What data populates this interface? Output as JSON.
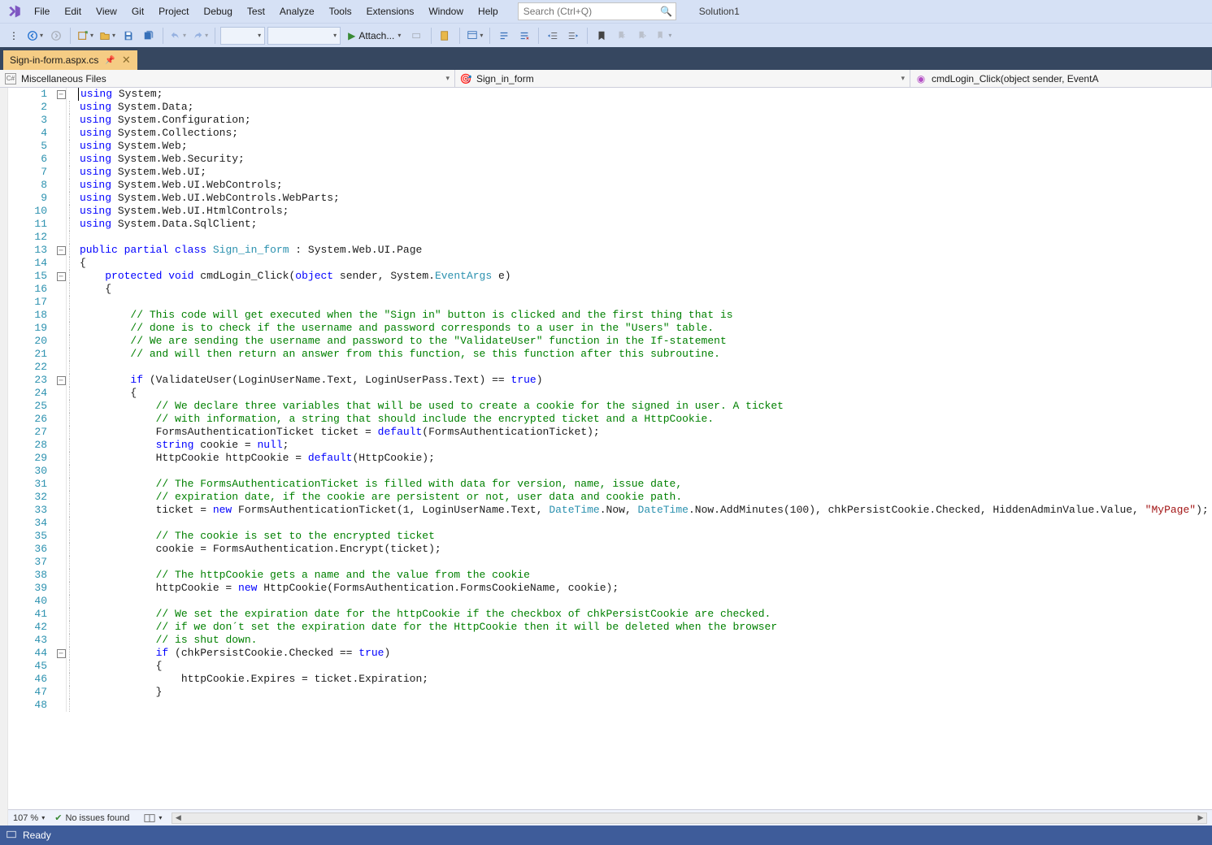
{
  "menu": {
    "file": "File",
    "edit": "Edit",
    "view": "View",
    "git": "Git",
    "project": "Project",
    "debug": "Debug",
    "test": "Test",
    "analyze": "Analyze",
    "tools": "Tools",
    "extensions": "Extensions",
    "window": "Window",
    "help": "Help"
  },
  "search_placeholder": "Search (Ctrl+Q)",
  "solution_name": "Solution1",
  "toolbar": {
    "attach": "Attach..."
  },
  "tab": {
    "filename": "Sign-in-form.aspx.cs"
  },
  "nav": {
    "project": "Miscellaneous Files",
    "class": "Sign_in_form",
    "member": "cmdLogin_Click(object sender, EventA"
  },
  "code": {
    "lines": [
      {
        "n": 1,
        "fold": "box",
        "guide": false,
        "html": "<span class='kw'>using</span> System;",
        "cursor": true
      },
      {
        "n": 2,
        "html": "<span class='kw'>using</span> System.Data;"
      },
      {
        "n": 3,
        "html": "<span class='kw'>using</span> System.Configuration;"
      },
      {
        "n": 4,
        "html": "<span class='kw'>using</span> System.Collections;"
      },
      {
        "n": 5,
        "html": "<span class='kw'>using</span> System.Web;"
      },
      {
        "n": 6,
        "html": "<span class='kw'>using</span> System.Web.Security;"
      },
      {
        "n": 7,
        "html": "<span class='kw'>using</span> System.Web.UI;"
      },
      {
        "n": 8,
        "html": "<span class='kw'>using</span> System.Web.UI.WebControls;"
      },
      {
        "n": 9,
        "html": "<span class='kw'>using</span> System.Web.UI.WebControls.WebParts;"
      },
      {
        "n": 10,
        "html": "<span class='kw'>using</span> System.Web.UI.HtmlControls;"
      },
      {
        "n": 11,
        "html": "<span class='kw'>using</span> System.Data.SqlClient;"
      },
      {
        "n": 12,
        "html": ""
      },
      {
        "n": 13,
        "fold": "box",
        "html": "<span class='kw'>public</span> <span class='kw'>partial</span> <span class='kw'>class</span> <span class='typ'>Sign_in_form</span> : System.Web.UI.Page"
      },
      {
        "n": 14,
        "html": "{"
      },
      {
        "n": 15,
        "fold": "box",
        "html": "    <span class='kw'>protected</span> <span class='kw'>void</span> cmdLogin_Click(<span class='kw'>object</span> sender, System.<span class='typ'>EventArgs</span> e)"
      },
      {
        "n": 16,
        "html": "    {"
      },
      {
        "n": 17,
        "html": ""
      },
      {
        "n": 18,
        "html": "        <span class='cm'>// This code will get executed when the \"Sign in\" button is clicked and the first thing that is</span>"
      },
      {
        "n": 19,
        "html": "        <span class='cm'>// done is to check if the username and password corresponds to a user in the \"Users\" table.</span>"
      },
      {
        "n": 20,
        "html": "        <span class='cm'>// We are sending the username and password to the \"ValidateUser\" function in the If-statement</span>"
      },
      {
        "n": 21,
        "html": "        <span class='cm'>// and will then return an answer from this function, se this function after this subroutine.</span>"
      },
      {
        "n": 22,
        "html": ""
      },
      {
        "n": 23,
        "fold": "box",
        "html": "        <span class='kw'>if</span> (ValidateUser(LoginUserName.Text, LoginUserPass.Text) == <span class='kw'>true</span>)"
      },
      {
        "n": 24,
        "html": "        {"
      },
      {
        "n": 25,
        "html": "            <span class='cm'>// We declare three variables that will be used to create a cookie for the signed in user. A ticket</span>"
      },
      {
        "n": 26,
        "html": "            <span class='cm'>// with information, a string that should include the encrypted ticket and a HttpCookie.</span>"
      },
      {
        "n": 27,
        "html": "            FormsAuthenticationTicket ticket = <span class='kw'>default</span>(FormsAuthenticationTicket);"
      },
      {
        "n": 28,
        "html": "            <span class='kw'>string</span> cookie = <span class='kw'>null</span>;"
      },
      {
        "n": 29,
        "html": "            HttpCookie httpCookie = <span class='kw'>default</span>(HttpCookie);"
      },
      {
        "n": 30,
        "html": ""
      },
      {
        "n": 31,
        "html": "            <span class='cm'>// The FormsAuthenticationTicket is filled with data for version, name, issue date,</span>"
      },
      {
        "n": 32,
        "html": "            <span class='cm'>// expiration date, if the cookie are persistent or not, user data and cookie path.</span>"
      },
      {
        "n": 33,
        "html": "            ticket = <span class='kw'>new</span> FormsAuthenticationTicket(1, LoginUserName.Text, <span class='typ'>DateTime</span>.Now, <span class='typ'>DateTime</span>.Now.AddMinutes(100), chkPersistCookie.Checked, HiddenAdminValue.Value, <span class='str'>\"MyPage\"</span>);"
      },
      {
        "n": 34,
        "html": ""
      },
      {
        "n": 35,
        "html": "            <span class='cm'>// The cookie is set to the encrypted ticket</span>"
      },
      {
        "n": 36,
        "html": "            cookie = FormsAuthentication.Encrypt(ticket);"
      },
      {
        "n": 37,
        "html": ""
      },
      {
        "n": 38,
        "html": "            <span class='cm'>// The httpCookie gets a name and the value from the cookie</span>"
      },
      {
        "n": 39,
        "html": "            httpCookie = <span class='kw'>new</span> HttpCookie(FormsAuthentication.FormsCookieName, cookie);"
      },
      {
        "n": 40,
        "html": ""
      },
      {
        "n": 41,
        "html": "            <span class='cm'>// We set the expiration date for the httpCookie if the checkbox of chkPersistCookie are checked.</span>"
      },
      {
        "n": 42,
        "html": "            <span class='cm'>// if we don´t set the expiration date for the HttpCookie then it will be deleted when the browser</span>"
      },
      {
        "n": 43,
        "html": "            <span class='cm'>// is shut down.</span>"
      },
      {
        "n": 44,
        "fold": "box",
        "html": "            <span class='kw'>if</span> (chkPersistCookie.Checked == <span class='kw'>true</span>)"
      },
      {
        "n": 45,
        "html": "            {"
      },
      {
        "n": 46,
        "html": "                httpCookie.Expires = ticket.Expiration;"
      },
      {
        "n": 47,
        "html": "            }"
      },
      {
        "n": 48,
        "html": ""
      }
    ]
  },
  "editstatus": {
    "zoom": "107 %",
    "issues": "No issues found"
  },
  "status": {
    "ready": "Ready"
  }
}
